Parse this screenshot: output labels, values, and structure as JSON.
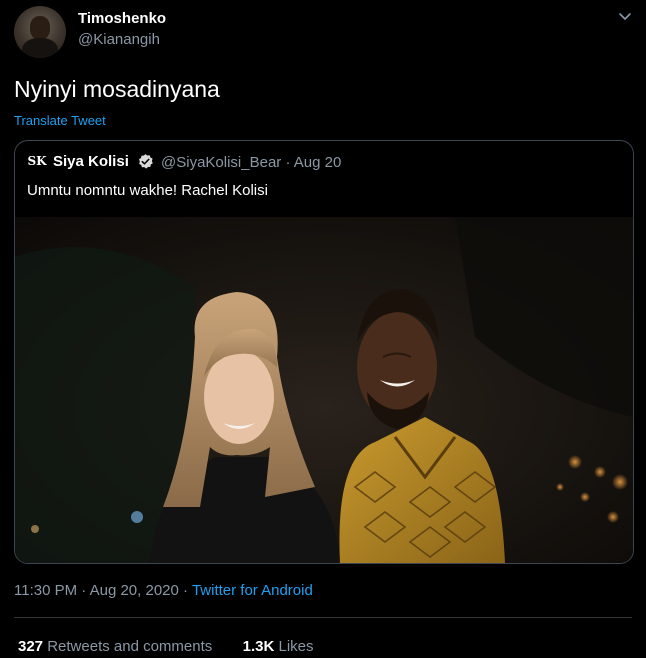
{
  "tweet": {
    "author": {
      "display_name": "Timoshenko",
      "handle": "@Kianangih"
    },
    "text": "Nyinyi mosadinyana",
    "translate_label": "Translate Tweet",
    "quoted": {
      "avatar_text": "SK",
      "author_name": "Siya Kolisi",
      "verified": true,
      "handle": "@SiyaKolisi_Bear",
      "date": "Aug 20",
      "text": "Umntu nomntu wakhe! Rachel Kolisi"
    },
    "time": "11:30 PM",
    "date": "Aug 20, 2020",
    "source": "Twitter for Android",
    "retweets_count": "327",
    "retweets_label": "Retweets and comments",
    "likes_count": "1.3K",
    "likes_label": "Likes"
  },
  "icons": {
    "menu": "chevron-down-icon",
    "verified": "verified-badge-icon"
  },
  "colors": {
    "background": "#000000",
    "accent": "#1da1f2",
    "muted_text": "#8b98a5",
    "verified": "#d9d9d9"
  }
}
